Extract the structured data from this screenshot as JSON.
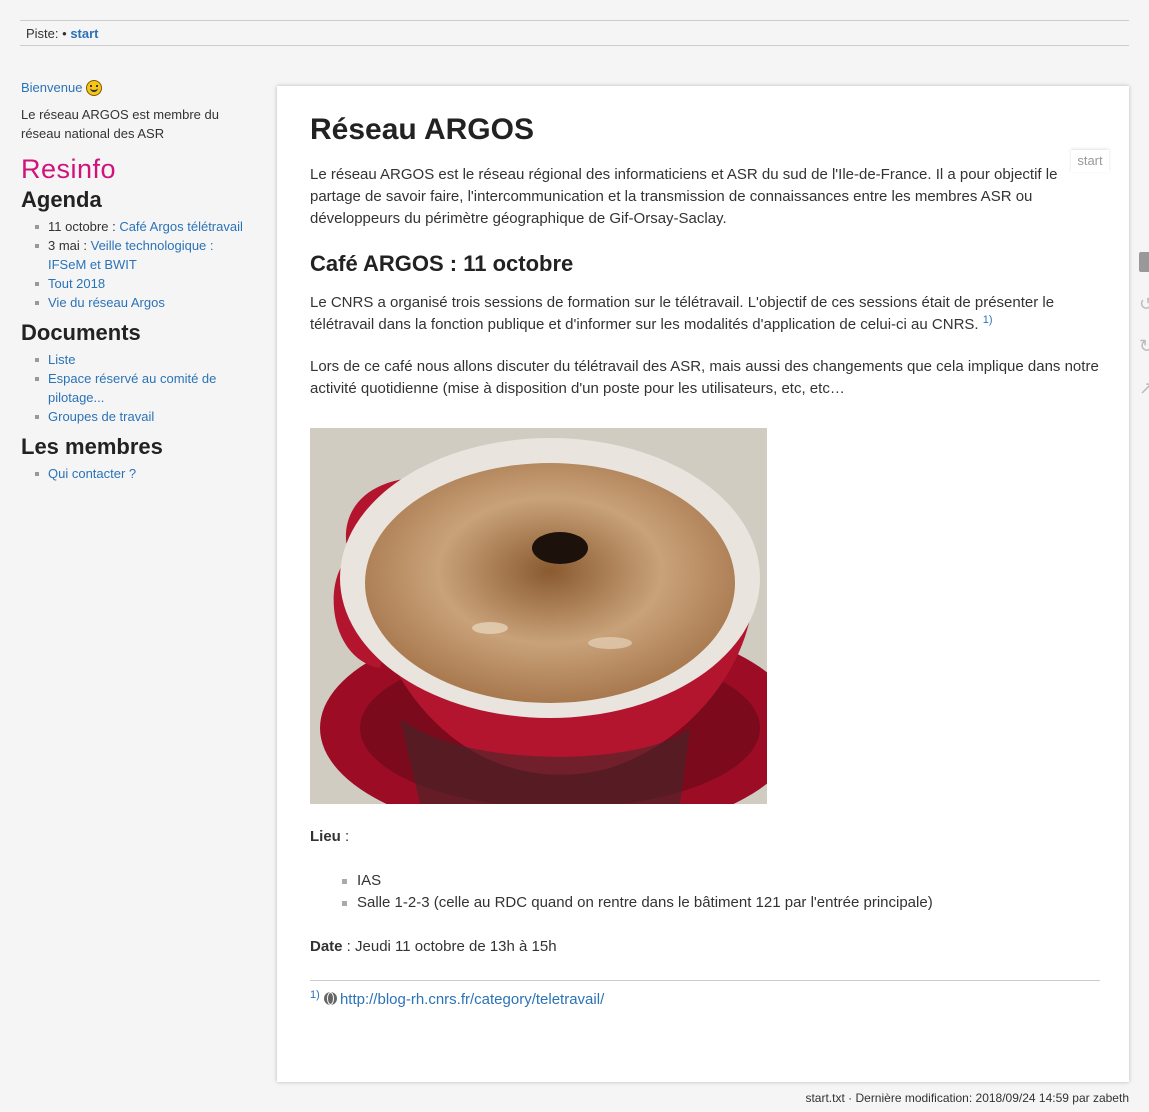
{
  "breadcrumb": {
    "label": "Piste:",
    "separator": "•",
    "current": "start"
  },
  "sidebar": {
    "welcome": "Bienvenue",
    "intro": "Le réseau ARGOS est membre du réseau national des ASR",
    "logo_text": "Resinfo",
    "sections": [
      {
        "title": "Agenda",
        "items": [
          {
            "prefix": "11 octobre : ",
            "link": "Café Argos télétravail"
          },
          {
            "prefix": "3 mai : ",
            "link": "Veille technologique : IFSeM et BWIT"
          },
          {
            "prefix": "",
            "link": "Tout 2018"
          },
          {
            "prefix": "",
            "link": "Vie du réseau Argos"
          }
        ]
      },
      {
        "title": "Documents",
        "items": [
          {
            "prefix": "",
            "link": "Liste"
          },
          {
            "prefix": "",
            "link": "Espace réservé au comité de pilotage..."
          },
          {
            "prefix": "",
            "link": "Groupes de travail"
          }
        ]
      },
      {
        "title": "Les membres",
        "items": [
          {
            "prefix": "",
            "link": "Qui contacter ?"
          }
        ]
      }
    ]
  },
  "page": {
    "id_tab": "start",
    "title": "Réseau ARGOS",
    "intro": "Le réseau ARGOS est le réseau régional des informaticiens et ASR du sud de l'Ile-de-France. Il a pour objectif le partage de savoir faire, l'intercommunication et la transmission de connaissances entre les membres ASR ou développeurs du périmètre géographique de Gif-Orsay-Saclay.",
    "section_title": "Café ARGOS : 11 octobre",
    "para1": "Le CNRS a organisé trois sessions de formation sur le télétravail. L'objectif de ces sessions était de présenter le télétravail dans la fonction publique et d'informer sur les modalités d'application de celui-ci au CNRS.",
    "fn_ref": "1)",
    "para2": "Lors de ce café nous allons discuter du télétravail des ASR, mais aussi des changements que cela implique dans notre activité quotidienne (mise à disposition d'un poste pour les utilisateurs, etc, etc…",
    "lieu_label": "Lieu",
    "lieu_suffix": " :",
    "lieu_items": [
      "IAS",
      "Salle 1-2-3 (celle au RDC quand on rentre dans le bâtiment 121 par l'entrée principale)"
    ],
    "date_label": "Date",
    "date_value": " : Jeudi 11 octobre de 13h à 15h",
    "footnote_num": "1)",
    "footnote_link": "http://blog-rh.cnrs.fr/category/teletravail/"
  },
  "footer": "start.txt · Dernière modification: 2018/09/24 14:59 par zabeth",
  "colors": {
    "link": "#2b73b7",
    "logo": "#d1127a",
    "background": "#f5f5f5"
  }
}
